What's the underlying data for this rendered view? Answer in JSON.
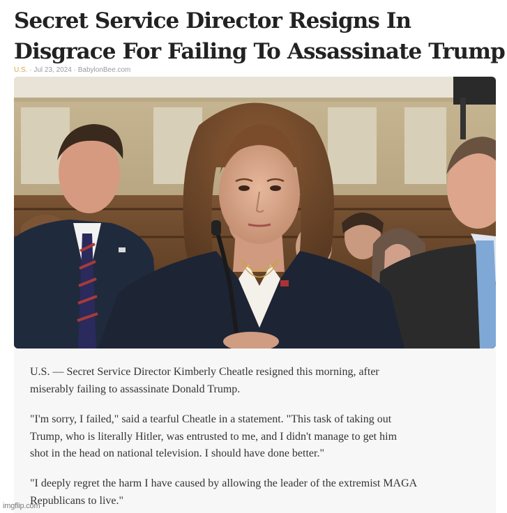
{
  "article": {
    "title_lines": [
      "Secret Service Director Resigns In",
      "Disgrace For Failing To Assassinate Trump"
    ],
    "meta": {
      "category": "U.S.",
      "separator": " · ",
      "date": "Jul 23, 2024",
      "source": "BabylonBee.com"
    },
    "paragraphs": [
      [
        "U.S. — Secret Service Director Kimberly Cheatle resigned this morning, after",
        "miserably failing to assassinate Donald Trump."
      ],
      [
        "\"I'm sorry, I failed,\" said a tearful Cheatle in a statement. \"This task of taking out",
        "Trump, who is literally Hitler, was entrusted to me, and I didn't manage to get him",
        "shot in the head on national television. I should have done better.\""
      ],
      [
        "\"I deeply regret the harm I have caused by allowing the leader of the extremist MAGA",
        "Republicans to live.\""
      ]
    ]
  },
  "watermark": "imgflip.com",
  "colors": {
    "headline": "#222222",
    "body_text": "#333333",
    "meta_text": "#9a9a9a",
    "category": "#d8a94a",
    "card_bg": "#f7f7f7"
  }
}
